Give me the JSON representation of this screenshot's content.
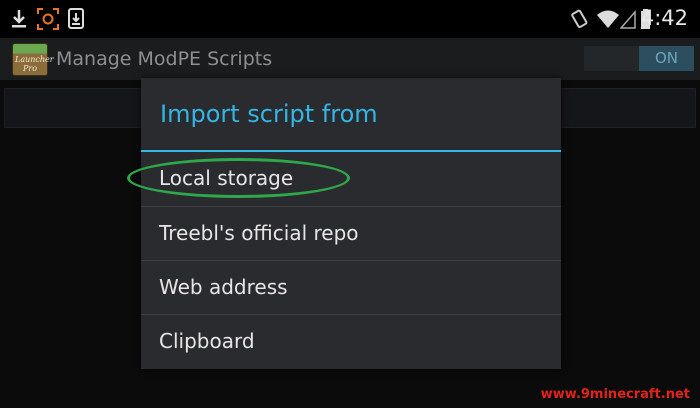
{
  "status_bar": {
    "time": "4:42",
    "left_icons": [
      "download-icon",
      "screen-capture-icon",
      "download-notification-icon"
    ],
    "right_icons": [
      "screen-rotation-icon",
      "wifi-icon",
      "signal-icon",
      "battery-icon"
    ]
  },
  "action_bar": {
    "app_icon_text": "Launcher Pro",
    "title": "Manage ModPE Scripts",
    "toggle_label": "ON"
  },
  "dialog": {
    "title": "Import script from",
    "items": [
      {
        "label": "Local storage"
      },
      {
        "label": "Treebl's official repo"
      },
      {
        "label": "Web address"
      },
      {
        "label": "Clipboard"
      }
    ]
  },
  "annotation": {
    "highlight_color": "#2ea84a",
    "highlighted_item": "Local storage"
  },
  "colors": {
    "accent": "#33b5e5",
    "watermark": "#e2231a"
  },
  "watermark": "www.9minecraft.net"
}
